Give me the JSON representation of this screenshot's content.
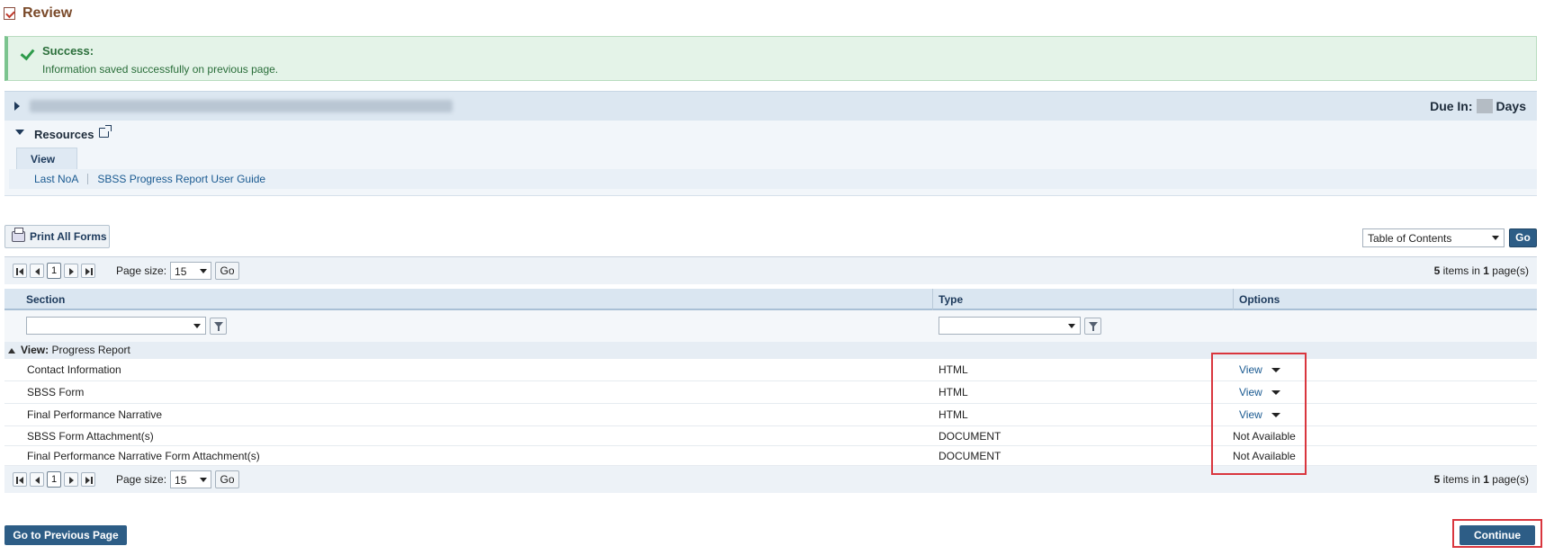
{
  "page": {
    "title": "Review"
  },
  "success": {
    "title": "Success:",
    "message": "Information saved successfully on previous page."
  },
  "grant_bar": {
    "due_label": "Due In:",
    "due_unit": "Days"
  },
  "resources": {
    "label": "Resources",
    "tab_label": "View",
    "links": [
      "Last NoA",
      "SBSS Progress Report User Guide"
    ]
  },
  "toolbar": {
    "print_label": "Print All Forms",
    "toc_selected": "Table of Contents",
    "toc_go": "Go"
  },
  "pager": {
    "current_page": "1",
    "page_size_label": "Page size:",
    "page_size_value": "15",
    "go_label": "Go",
    "items_count": "5",
    "pages_count": "1"
  },
  "grid": {
    "columns": [
      "Section",
      "Type",
      "Options"
    ],
    "group": {
      "label": "View:",
      "value": "Progress Report"
    },
    "rows": [
      {
        "section": "Contact Information",
        "type": "HTML",
        "option": "View",
        "has_menu": true
      },
      {
        "section": "SBSS Form",
        "type": "HTML",
        "option": "View",
        "has_menu": true
      },
      {
        "section": "Final Performance Narrative",
        "type": "HTML",
        "option": "View",
        "has_menu": true
      },
      {
        "section": "SBSS Form Attachment(s)",
        "type": "DOCUMENT",
        "option": "Not Available",
        "has_menu": false
      },
      {
        "section": "Final Performance Narrative Form Attachment(s)",
        "type": "DOCUMENT",
        "option": "Not Available",
        "has_menu": false
      }
    ]
  },
  "footer": {
    "prev_label": "Go to Previous Page",
    "continue_label": "Continue"
  },
  "colors": {
    "accent": "#2d5d86",
    "highlight": "#d9363e",
    "success_text": "#2a6e3a"
  }
}
